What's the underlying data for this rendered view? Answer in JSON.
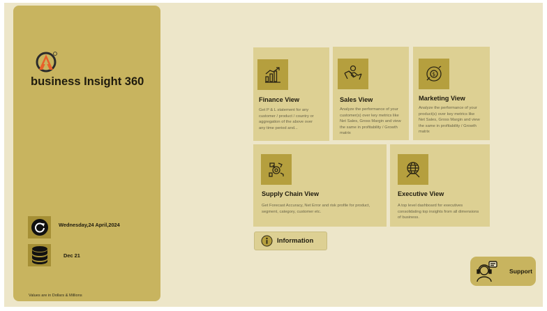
{
  "app": {
    "brand": "business Insight 360"
  },
  "sidebar": {
    "date": "Wednesday,24 April,2024",
    "refresh_label": "Dec 21",
    "footnote": "Values are in Dollars & Millions"
  },
  "cards": [
    {
      "title": "Finance View",
      "icon": "finance-chart-icon",
      "desc": "Get P & L statement for any customer / product / country or aggregation of the above over any time period and..."
    },
    {
      "title": "Sales View",
      "icon": "handshake-icon",
      "desc": "Analyze the performance of your customer(s) over key metrics like Net Sales, Gross Margin and view the same in profitability / Growth matrix"
    },
    {
      "title": "Marketing View",
      "icon": "marketing-icon",
      "desc": "Analyze the performance of your product(s) over key metrics like Net Sales, Gross Margin and view the same in profitability / Growth matrix"
    },
    {
      "title": "Supply Chain View",
      "icon": "supply-chain-icon",
      "desc": "Get Forecast Accuracy, Net Error and risk profile for product, segment, category, customer etc."
    },
    {
      "title": "Executive View",
      "icon": "executive-globe-icon",
      "desc": "A top level dashboard for executives consolidating top insights from all dimensions of business."
    }
  ],
  "buttons": {
    "information": "Information",
    "support": "Support"
  },
  "colors": {
    "background": "#ede6c9",
    "sidebar": "#c8b45f",
    "card": "#ddd093",
    "icon_tile": "#b59f3e",
    "logo_orange": "#e8602a"
  }
}
